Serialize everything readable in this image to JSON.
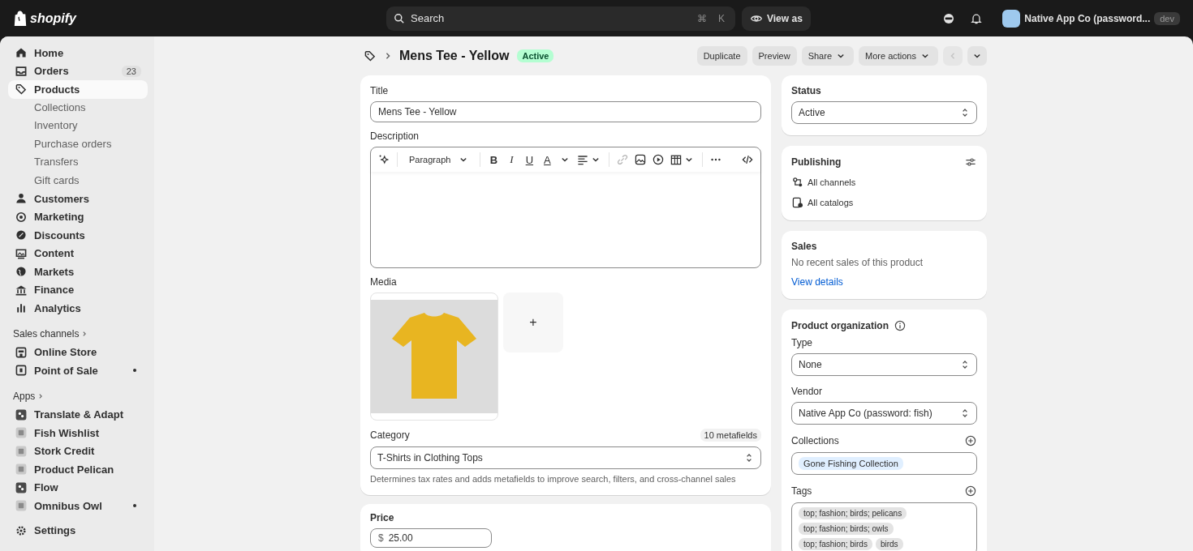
{
  "topbar": {
    "logo": "shopify",
    "search": {
      "placeholder": "Search",
      "shortcut": [
        "⌘",
        "K"
      ]
    },
    "view_as": "View as",
    "store": {
      "name": "Native App Co (password...",
      "badge": "dev"
    }
  },
  "sidebar": {
    "nav": [
      {
        "label": "Home",
        "selected": false
      },
      {
        "label": "Orders",
        "selected": false,
        "badge": "23"
      },
      {
        "label": "Products",
        "selected": true,
        "children": [
          {
            "label": "Collections"
          },
          {
            "label": "Inventory"
          },
          {
            "label": "Purchase orders"
          },
          {
            "label": "Transfers"
          },
          {
            "label": "Gift cards"
          }
        ]
      },
      {
        "label": "Customers",
        "selected": false
      },
      {
        "label": "Marketing",
        "selected": false
      },
      {
        "label": "Discounts",
        "selected": false
      },
      {
        "label": "Content",
        "selected": false
      },
      {
        "label": "Markets",
        "selected": false
      },
      {
        "label": "Finance",
        "selected": false
      },
      {
        "label": "Analytics",
        "selected": false
      }
    ],
    "sections": [
      {
        "title": "Sales channels",
        "items": [
          {
            "label": "Online Store",
            "dot": false
          },
          {
            "label": "Point of Sale",
            "dot": true
          }
        ]
      },
      {
        "title": "Apps",
        "items": [
          {
            "label": "Translate & Adapt",
            "dot": false
          },
          {
            "label": "Fish Wishlist",
            "dot": false
          },
          {
            "label": "Stork Credit",
            "dot": false
          },
          {
            "label": "Product Pelican",
            "dot": false
          },
          {
            "label": "Flow",
            "dot": false
          },
          {
            "label": "Omnibus Owl",
            "dot": true
          }
        ]
      }
    ],
    "settings": "Settings"
  },
  "header": {
    "title": "Mens Tee - Yellow",
    "status": "Active",
    "actions": [
      {
        "label": "Duplicate",
        "caret": false
      },
      {
        "label": "Preview",
        "caret": false
      },
      {
        "label": "Share",
        "caret": true
      },
      {
        "label": "More actions",
        "caret": true
      }
    ],
    "pager": [
      {
        "kind": "previous",
        "disabled": true
      },
      {
        "kind": "next",
        "disabled": false
      }
    ]
  },
  "product": {
    "title_label": "Title",
    "title_value": "Mens Tee - Yellow",
    "description_label": "Description",
    "editor": {
      "block_style": "Paragraph",
      "format_buttons": [
        "B",
        "I",
        "U",
        "A"
      ]
    },
    "media_label": "Media",
    "add_media": "+",
    "category_label": "Category",
    "metafields": "10 metafields",
    "category_value": "T-Shirts in Clothing Tops",
    "category_help": "Determines tax rates and adds metafields to improve search, filters, and cross-channel sales"
  },
  "price": {
    "label": "Price",
    "currency": "$",
    "value": "25.00"
  },
  "status_card": {
    "label": "Status",
    "value": "Active"
  },
  "publishing": {
    "label": "Publishing",
    "items": [
      "All channels",
      "All catalogs"
    ]
  },
  "sales": {
    "label": "Sales",
    "text": "No recent sales of this product",
    "link": "View details"
  },
  "organization": {
    "label": "Product organization",
    "type_label": "Type",
    "type_value": "None",
    "vendor_label": "Vendor",
    "vendor_value": "Native App Co (password: fish)",
    "collections_label": "Collections",
    "collections": [
      "Gone Fishing Collection"
    ],
    "tags_label": "Tags",
    "tags": [
      "top; fashion; birds; pelicans",
      "top; fashion; birds; owls",
      "top; fashion; birds",
      "birds"
    ]
  }
}
